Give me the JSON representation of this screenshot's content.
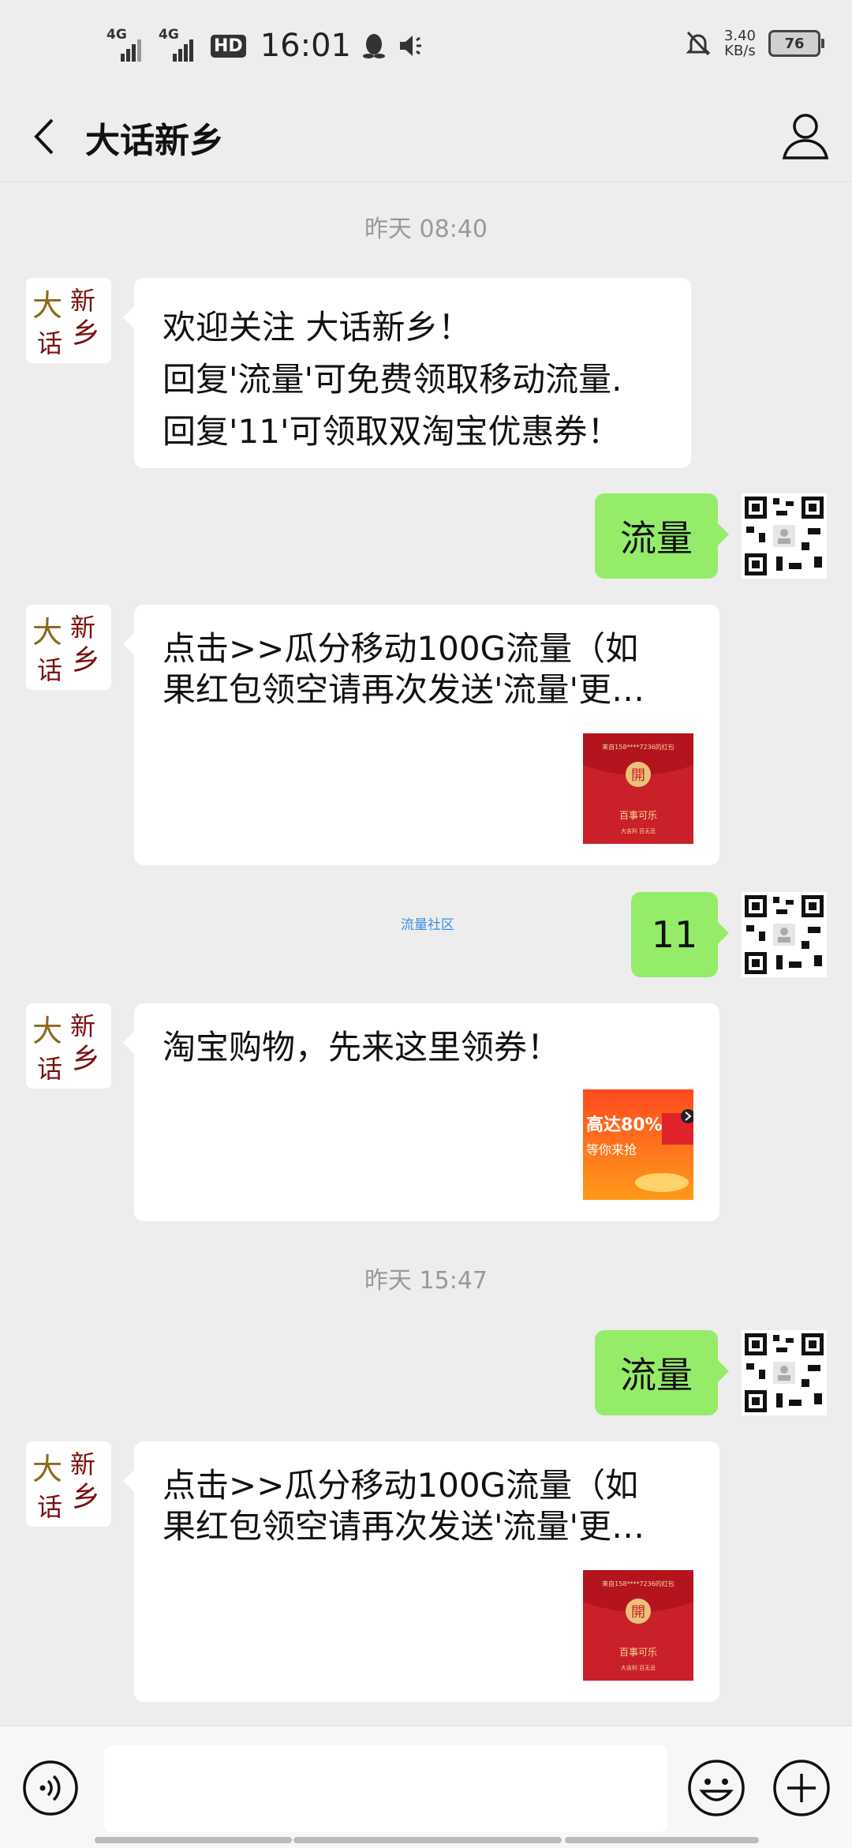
{
  "status_bar": {
    "signal1": "4G",
    "signal2": "4G",
    "hd": "HD",
    "time": "16:01",
    "net_speed_value": "3.40",
    "net_speed_unit": "KB/s",
    "battery": "76",
    "icons": [
      "qq-icon",
      "volume-icon",
      "alarm-off-icon"
    ]
  },
  "header": {
    "title": "大话新乡"
  },
  "chat": {
    "timestamps": [
      "昨天 08:40",
      "昨天 15:47"
    ],
    "avatar_text": {
      "a": "大",
      "b": "新",
      "c": "话",
      "d": "乡"
    },
    "messages": [
      {
        "side": "left",
        "lines": [
          "欢迎关注 大话新乡！",
          "回复'流量'可免费领取移动流量.",
          "回复'11'可领取双淘宝优惠券！"
        ]
      },
      {
        "side": "right",
        "text": "流量"
      },
      {
        "side": "left",
        "type": "link",
        "lines": [
          "点击>>瓜分移动100G流量（如",
          "果红包领空请再次发送'流量'更…"
        ],
        "thumb": {
          "title_small": "来自158****7236的红包",
          "open": "開",
          "brand": "百事可乐",
          "caption_small": "大吉利 百无忌"
        }
      },
      {
        "side": "right",
        "text": "11"
      },
      {
        "side": "left",
        "type": "link",
        "lines": [
          "淘宝购物，先来这里领券！"
        ],
        "thumb": {
          "line1": "高达80%",
          "line2": "等你来抢"
        }
      },
      {
        "side": "right",
        "text": "流量"
      },
      {
        "side": "left",
        "type": "link",
        "lines": [
          "点击>>瓜分移动100G流量（如",
          "果红包领空请再次发送'流量'更…"
        ],
        "thumb": {
          "title_small": "来自158****7236的红包",
          "open": "開",
          "brand": "百事可乐",
          "caption_small": "大吉利 百无忌"
        }
      }
    ],
    "watermark": "流量社区"
  },
  "input_bar": {
    "placeholder": "",
    "icons": [
      "voice-icon",
      "emoji-icon",
      "plus-icon"
    ]
  },
  "colors": {
    "background": "#ededed",
    "bubble_sent": "#95ec69",
    "bubble_received": "#ffffff",
    "red_packet": "#c9202a"
  }
}
